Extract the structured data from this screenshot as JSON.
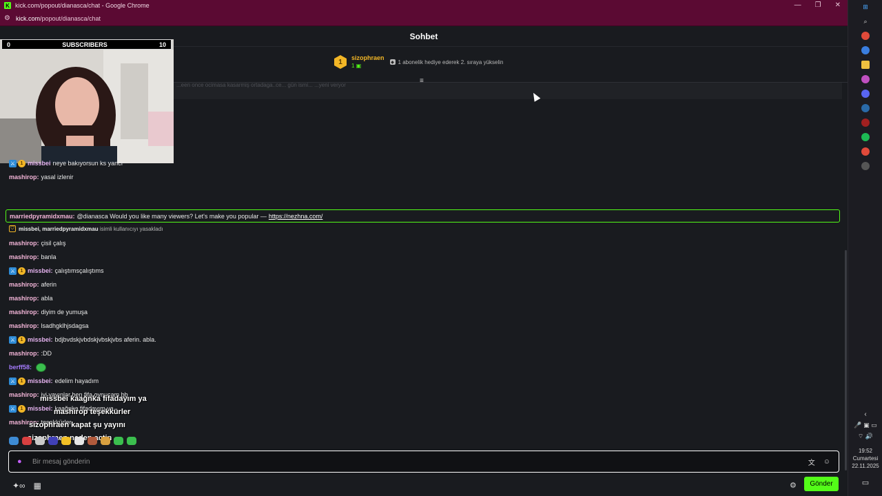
{
  "window": {
    "title": "kick.com/popout/dianasca/chat - Google Chrome",
    "url_host": "kick.com",
    "url_path": "/popout/dianasca/chat",
    "controls": {
      "minimize": "—",
      "restore": "❐",
      "close": "✕"
    }
  },
  "header": {
    "title": "Sohbet"
  },
  "pinned": {
    "rank": "1",
    "username": "sizophraen",
    "count": "1",
    "hint": "1 abonelik hediye ederek 2. sıraya yükselin"
  },
  "ghost_text": "...een once ocimasa kasarmiş ortadaga..ce... gün ismi... ...yeni veryor",
  "webcam": {
    "label_left": "0",
    "label_center": "SUBSCRIBERS",
    "label_right": "10"
  },
  "messages": [
    {
      "user": "missbei",
      "text": "neye bakıyorsun ks yancı",
      "badges": true
    },
    {
      "user": "mashirop",
      "text": "yasal izlenir",
      "badges": false
    },
    {
      "user": "mashirop",
      "text": "çisil çalış",
      "badges": false
    },
    {
      "user": "mashirop",
      "text": "banla",
      "badges": false
    },
    {
      "user": "missbei",
      "text": "çalıştımsçalıştıms",
      "badges": true
    },
    {
      "user": "mashirop",
      "text": "aferin",
      "badges": false
    },
    {
      "user": "mashirop",
      "text": "abla",
      "badges": false
    },
    {
      "user": "mashirop",
      "text": "diyim de yumuşa",
      "badges": false
    },
    {
      "user": "mashirop",
      "text": "lsadhgklhjsdagsa",
      "badges": false
    },
    {
      "user": "missbei",
      "text": "bdjbvdskjvbdskjvbskjvbs aferin. abla.",
      "badges": true
    },
    {
      "user": "mashirop",
      "text": ":DD",
      "badges": false
    },
    {
      "user": "berff58",
      "text": "",
      "badges": false
    },
    {
      "user": "missbei",
      "text": "edelim hayadım",
      "badges": true
    },
    {
      "user": "mashirop",
      "text": "iyi yayınlar ben fifa oynucam bb",
      "badges": false
    },
    {
      "user": "missbei",
      "text": "kaağnka fifadayım ya",
      "badges": true
    },
    {
      "user": "mashirop",
      "text": "teşekkürler",
      "badges": false
    }
  ],
  "highlight": {
    "user": "marriedpyramidxmau",
    "text": "@dianasca Would you like many viewers? Let's make you popular —",
    "link": "https://nezhna.com/"
  },
  "ban": {
    "users": "missbei, marriedpyramidxmau",
    "text": "isimli kullanıcıyı yasakladı"
  },
  "overlay": [
    {
      "text": "missbei  kaağnka fifadayım ya"
    },
    {
      "text": "mashirop  teşekkürler"
    },
    {
      "text": "sizophraen  kapat şu yayını"
    },
    {
      "text": "sizophraen  neden actin"
    }
  ],
  "input": {
    "placeholder": "Bir mesaj gönderin"
  },
  "footer": {
    "send_label": "Gönder"
  },
  "taskbar": {
    "time": "19:52",
    "day": "Cumartesi",
    "date": "22.11.2025"
  },
  "colors": {
    "accent": "#53fc18",
    "chrome_bar": "#5b0a33",
    "background": "#191b1f",
    "subscriber_gold": "#f2b626"
  }
}
